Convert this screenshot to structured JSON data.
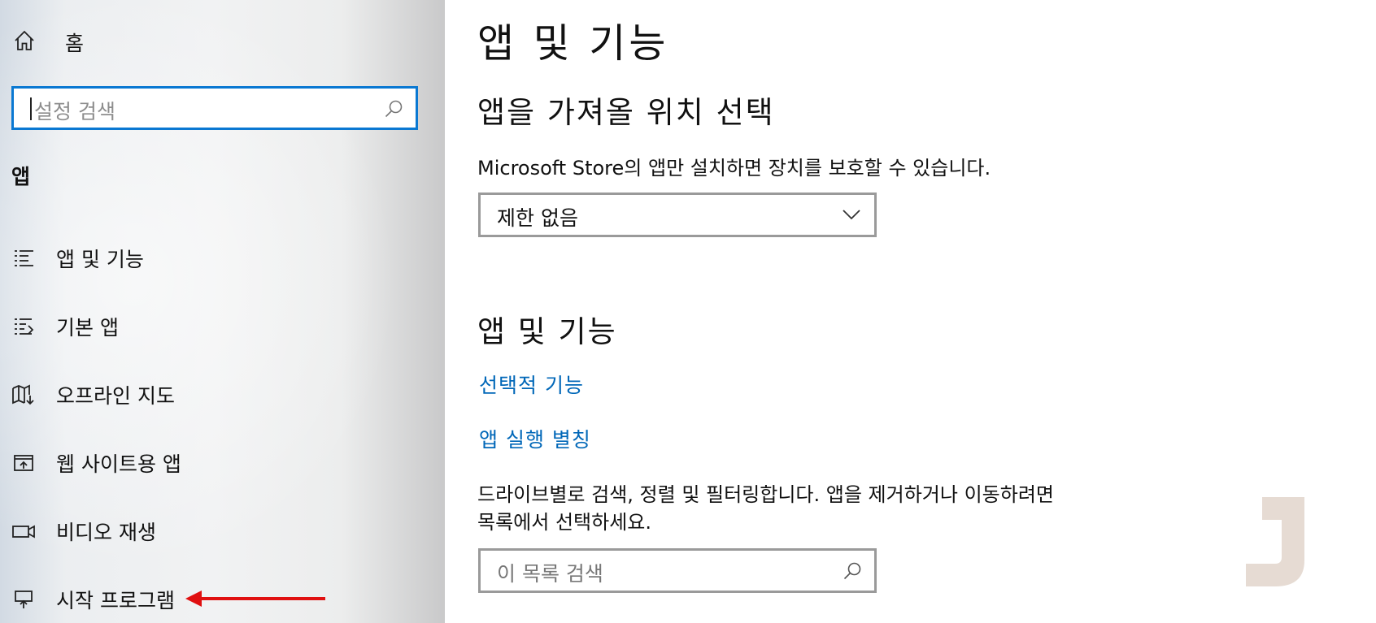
{
  "sidebar": {
    "home_label": "홈",
    "search_placeholder": "설정 검색",
    "section_title": "앱",
    "items": [
      {
        "label": "앱 및 기능",
        "icon": "apps-list-icon"
      },
      {
        "label": "기본 앱",
        "icon": "default-apps-icon"
      },
      {
        "label": "오프라인 지도",
        "icon": "offline-map-icon"
      },
      {
        "label": "웹 사이트용 앱",
        "icon": "web-app-icon"
      },
      {
        "label": "비디오 재생",
        "icon": "video-playback-icon"
      },
      {
        "label": "시작 프로그램",
        "icon": "startup-icon"
      }
    ]
  },
  "main": {
    "page_title": "앱 및 기능",
    "install_source": {
      "heading": "앱을 가져올 위치 선택",
      "description": "Microsoft Store의 앱만 설치하면 장치를 보호할 수 있습니다.",
      "dropdown_value": "제한 없음"
    },
    "apps_features": {
      "heading": "앱 및 기능",
      "link_optional": "선택적 기능",
      "link_alias": "앱 실행 별칭",
      "description_line1": "드라이브별로 검색, 정렬 및 필터링합니다. 앱을 제거하거나 이동하려면",
      "description_line2": "목록에서 선택하세요.",
      "search_placeholder": "이 목록 검색"
    }
  },
  "colors": {
    "accent": "#0a78d2",
    "link": "#0067b8",
    "annotation_arrow": "#e01010"
  }
}
